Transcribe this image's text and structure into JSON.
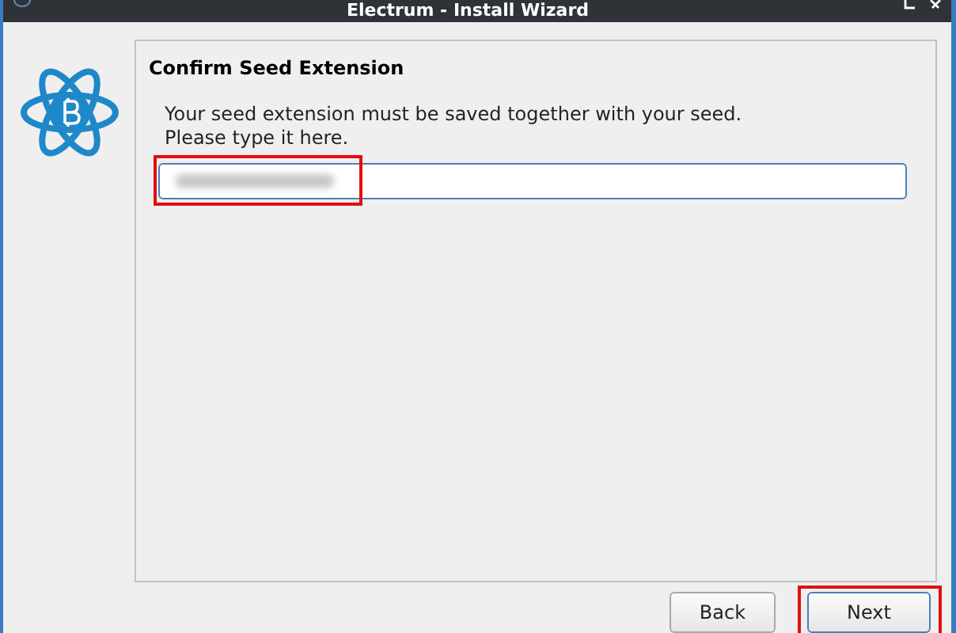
{
  "window": {
    "title": "Electrum  -  Install Wizard"
  },
  "page": {
    "heading": "Confirm Seed Extension",
    "message_lines": [
      "Your seed extension must be saved together with your seed.",
      "Please type it here."
    ]
  },
  "seed_field": {
    "kind": "blurred",
    "highlighted": true
  },
  "buttons": [
    {
      "label": "Back",
      "default": false,
      "highlighted": false
    },
    {
      "label": "Next",
      "default": true,
      "highlighted": true
    }
  ]
}
